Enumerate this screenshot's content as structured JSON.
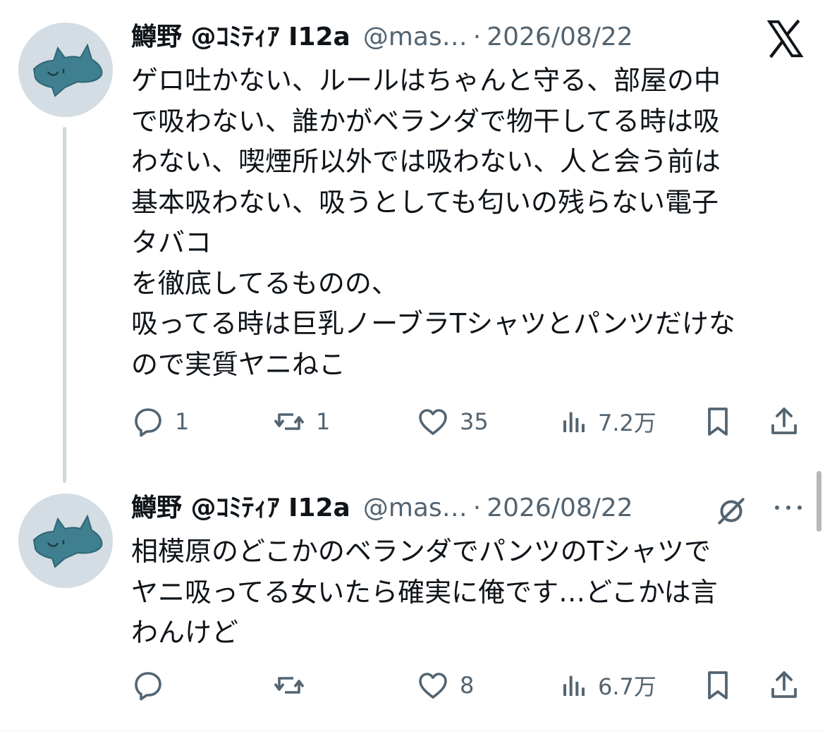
{
  "colors": {
    "text_primary": "#0f1419",
    "text_secondary": "#536471",
    "thread_line": "#cfd9de",
    "avatar_bg": "#d3dde3",
    "avatar_figure": "#3f7f8f"
  },
  "tweets": [
    {
      "author": {
        "display_name": "鱒野 @ｺﾐﾃｨｱ I12a",
        "handle": "@mas…",
        "avatar_icon": "cat-doodle-avatar"
      },
      "dot": "·",
      "date": "2026/08/22",
      "top_right_icon": "x-logo-icon",
      "body_lines": [
        "ゲロ吐かない、ルールはちゃんと守る、部屋の中",
        "で吸わない、誰かがベランダで物干してる時は吸",
        "わない、喫煙所以外では吸わない、人と会う前は",
        "基本吸わない、吸うとしても匂いの残らない電子",
        "タバコ",
        "を徹底してるものの、",
        "吸ってる時は巨乳ノーブラTシャツとパンツだけな",
        "ので実質ヤニねこ"
      ],
      "actions": {
        "replies": "1",
        "reposts": "1",
        "likes": "35",
        "views": "7.2万"
      }
    },
    {
      "author": {
        "display_name": "鱒野 @ｺﾐﾃｨｱ I12a",
        "handle": "@mas…",
        "avatar_icon": "cat-doodle-avatar"
      },
      "dot": "·",
      "date": "2026/08/22",
      "top_right_icons": [
        "grok-icon",
        "more-icon"
      ],
      "body_lines": [
        "相模原のどこかのベランダでパンツのTシャツで",
        "ヤニ吸ってる女いたら確実に俺です…どこかは言",
        "わんけど"
      ],
      "actions": {
        "replies": "",
        "reposts": "",
        "likes": "8",
        "views": "6.7万"
      }
    }
  ]
}
